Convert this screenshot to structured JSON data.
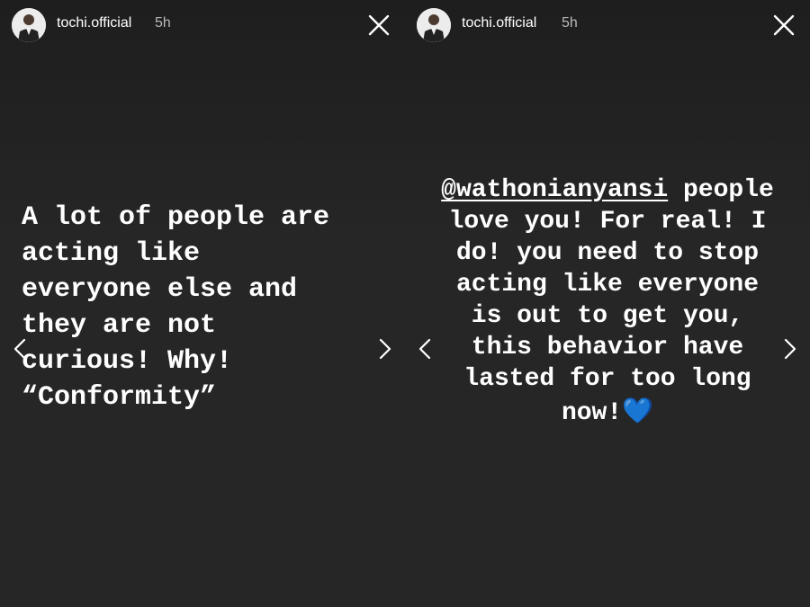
{
  "stories": [
    {
      "username": "tochi.official",
      "time": "5h",
      "text": "A lot of people are\nacting like\neveryone else and\nthey are not\ncurious! Why!\n“Conformity”"
    },
    {
      "username": "tochi.official",
      "time": "5h",
      "mention": "@wathonianyansi",
      "text_line1_rest": " people",
      "text_rest": "love you! For real! I\ndo! you need to stop\nacting like everyone\nis out to get you,\nthis behavior have\nlasted for too long\nnow!",
      "emoji": "💙"
    }
  ],
  "icons": {
    "close": "close-icon",
    "prev": "chevron-left-icon",
    "next": "chevron-right-icon"
  },
  "colors": {
    "background": "#242424",
    "text": "#ffffff",
    "timestamp": "#b9b9b9",
    "heart": "#3d8bf0"
  }
}
